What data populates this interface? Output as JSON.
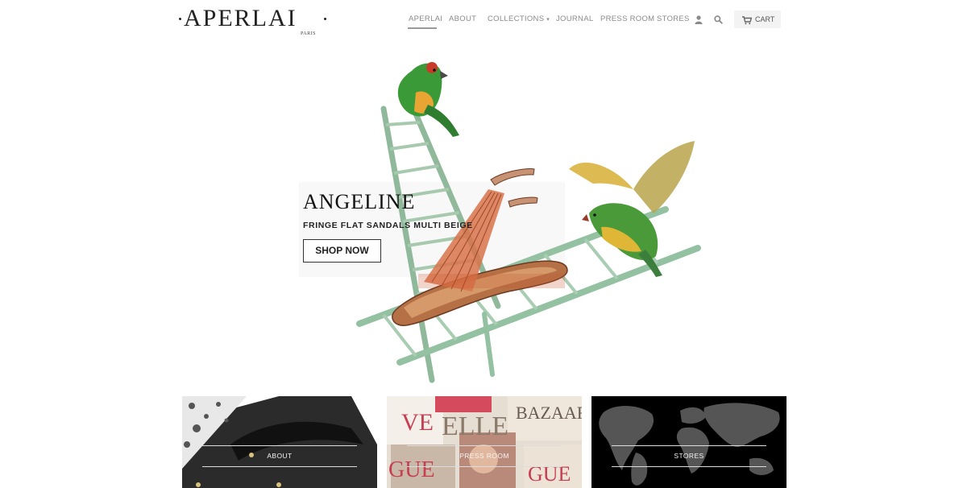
{
  "brand": {
    "name": "APERLAI",
    "sub": "PARIS"
  },
  "nav": {
    "items": [
      "APERLAI",
      "ABOUT",
      "COLLECTIONS",
      "JOURNAL",
      "PRESS ROOM",
      "STORES"
    ],
    "collections_caret": "▾",
    "active": "APERLAI",
    "cart_label": "CART"
  },
  "hero": {
    "title": "ANGELINE",
    "subtitle": "FRINGE FLAT SANDALS MULTI BEIGE",
    "cta": "SHOP NOW"
  },
  "tiles": [
    {
      "label": "ABOUT"
    },
    {
      "label": "PRESS ROOM"
    },
    {
      "label": "STORES"
    }
  ],
  "colors": {
    "accent": "#9a9a9a",
    "text": "#222222",
    "parrot_green": "#3f9a3a",
    "ladder_green": "#8fbf9c"
  }
}
